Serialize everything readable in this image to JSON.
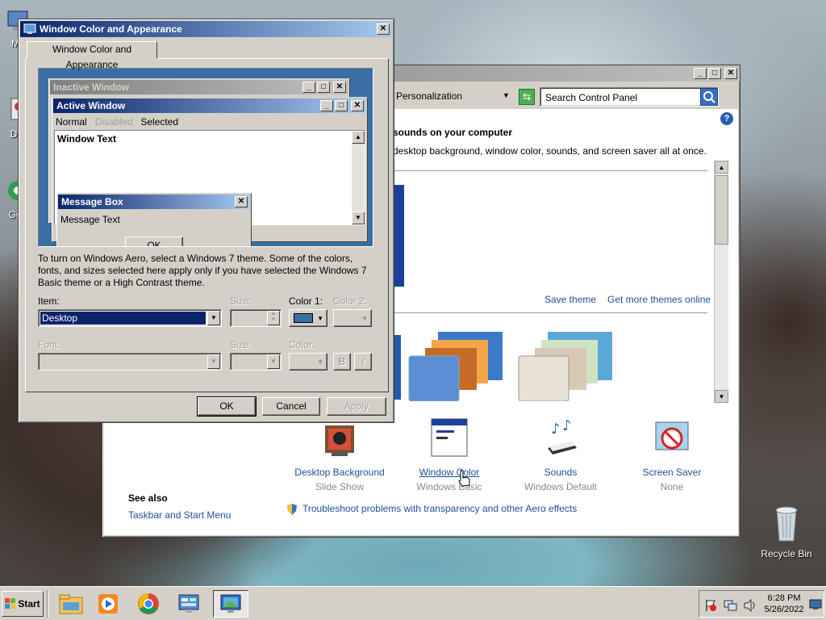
{
  "desktop": {
    "icons_left": [
      {
        "label": "My"
      },
      {
        "label": "Dat"
      },
      {
        "label": "Goo"
      }
    ],
    "recycle_bin": {
      "label": "Recycle Bin"
    }
  },
  "control_panel": {
    "address": "Personalization",
    "search_placeholder": "Search Control Panel",
    "heading": "sounds on your computer",
    "description": "desktop background, window color, sounds, and screen saver all at once.",
    "save_theme": "Save theme",
    "get_more_themes": "Get more themes online",
    "bottom_items": [
      {
        "label": "Desktop Background",
        "sub": "Slide Show",
        "icon": "desktop-background-icon"
      },
      {
        "label": "Window Color",
        "sub": "Windows Basic",
        "icon": "window-color-icon"
      },
      {
        "label": "Sounds",
        "sub": "Windows Default",
        "icon": "sounds-icon"
      },
      {
        "label": "Screen Saver",
        "sub": "None",
        "icon": "screen-saver-icon"
      }
    ],
    "see_also": "See also",
    "taskbar_link": "Taskbar and Start Menu",
    "troubleshoot_link": "Troubleshoot problems with transparency and other Aero effects"
  },
  "dialog": {
    "title": "Window Color and Appearance",
    "tab": "Window Color and Appearance",
    "preview": {
      "inactive_title": "Inactive Window",
      "active_title": "Active Window",
      "menu_normal": "Normal",
      "menu_disabled": "Disabled",
      "menu_selected": "Selected",
      "window_text": "Window Text",
      "msgbox_title": "Message Box",
      "msgbox_text": "Message Text",
      "msgbox_ok": "OK"
    },
    "info_text": "To turn on Windows Aero, select a Windows 7 theme.  Some of the colors, fonts, and sizes selected here apply only if you have selected the Windows 7 Basic theme or a High Contrast theme.",
    "item_label": "Item:",
    "item_value": "Desktop",
    "size_label": "Size:",
    "color1_label": "Color 1:",
    "color2_label": "Color 2:",
    "font_label": "Font:",
    "font_size_label": "Size:",
    "font_color_label": "Color:",
    "bold_label": "B",
    "italic_label": "I",
    "ok": "OK",
    "cancel": "Cancel",
    "apply": "Apply"
  },
  "taskbar": {
    "start": "Start",
    "time": "6:28 PM",
    "date": "5/26/2022"
  },
  "colors": {
    "title_active": "#0a246a",
    "preview_desktop": "#3a6ea5",
    "color1_swatch": "#3a6ea5",
    "link": "#1f4e9b"
  }
}
